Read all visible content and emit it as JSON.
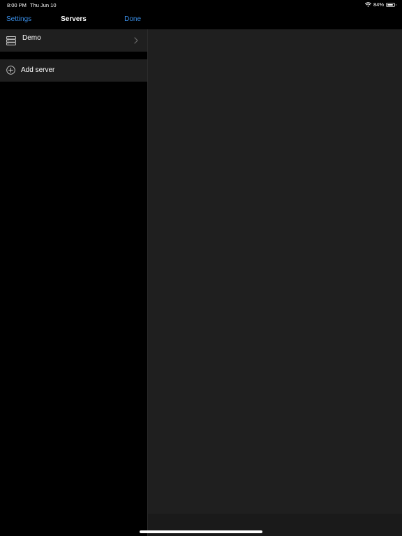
{
  "status_bar": {
    "time": "8:00 PM",
    "date": "Thu Jun 10",
    "battery": "84%",
    "battery_level": 0.84,
    "wifi_icon": "wifi-icon",
    "battery_icon": "battery-icon"
  },
  "nav": {
    "left_label": "Settings",
    "title": "Servers",
    "right_label": "Done"
  },
  "servers": [
    {
      "name": "Demo",
      "icon": "server-icon"
    }
  ],
  "add_server": {
    "label": "Add server",
    "icon": "plus-circle-icon"
  },
  "colors": {
    "accent": "#3a8ee6",
    "background": "#000000",
    "row": "#1f1f1f",
    "detail": "#1f1f1f"
  }
}
